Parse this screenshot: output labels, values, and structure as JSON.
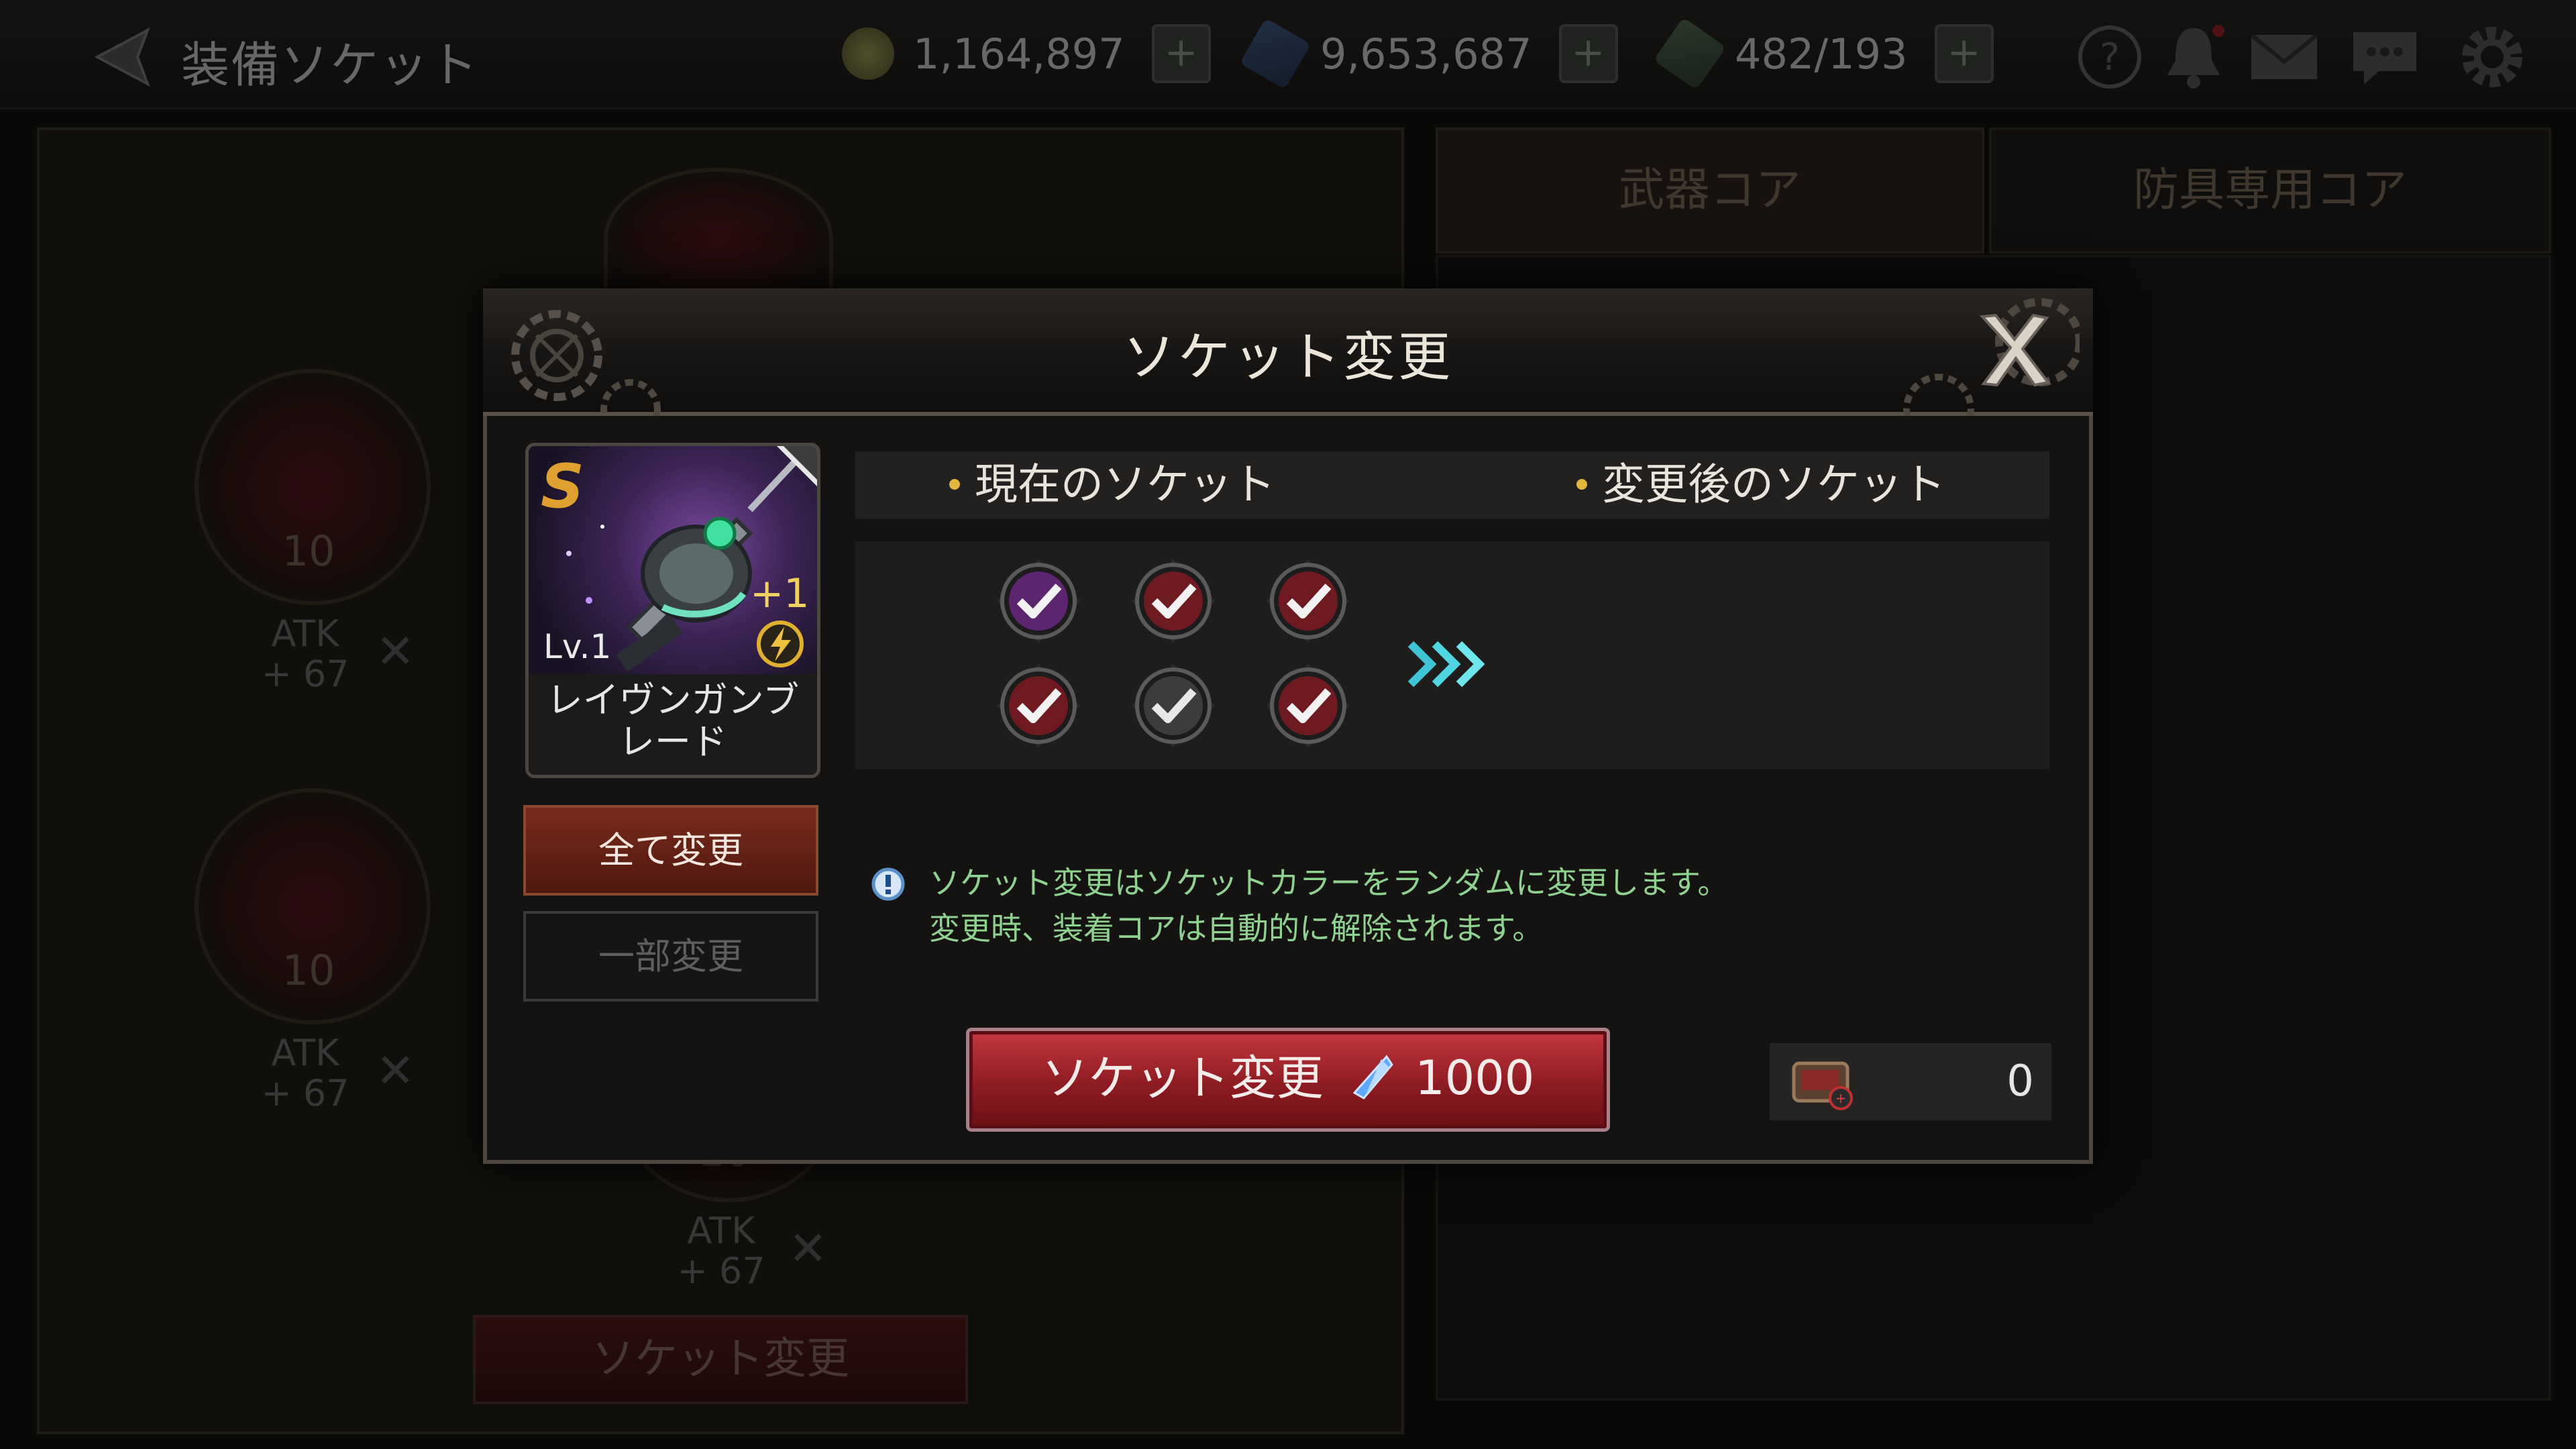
{
  "background": {
    "screen_title": "装備ソケット",
    "currencies": [
      {
        "name": "gold",
        "value": "1,164,897",
        "icon": "gold-icon"
      },
      {
        "name": "crystal",
        "value": "9,653,687",
        "icon": "crystal-icon"
      },
      {
        "name": "stamina",
        "value": "482/193",
        "icon": "stamina-icon"
      }
    ],
    "top_icons": [
      "help-icon",
      "bell-icon",
      "mail-icon",
      "chat-icon",
      "gear-icon"
    ],
    "tabs": [
      "武器コア",
      "防具専用コア"
    ],
    "slots": [
      {
        "number": "10",
        "stat_label": "ATK",
        "stat_value": "+ 67"
      },
      {
        "number": "10",
        "stat_label": "ATK",
        "stat_value": "+ 67"
      },
      {
        "number": "10",
        "stat_label": "ATK",
        "stat_value": "+ 67"
      }
    ],
    "socket_change_button": "ソケット変更"
  },
  "dialog": {
    "title": "ソケット変更",
    "item": {
      "grade": "S",
      "level": "Lv.1",
      "enhance": "+1",
      "name": "レイヴンガンブレード"
    },
    "mode_buttons": {
      "all": "全て変更",
      "partial": "一部変更"
    },
    "sockets_header": {
      "current": "現在のソケット",
      "after": "変更後のソケット"
    },
    "current_sockets": [
      {
        "color": "purple"
      },
      {
        "color": "red"
      },
      {
        "color": "red"
      },
      {
        "color": "red"
      },
      {
        "color": "gray"
      },
      {
        "color": "red"
      }
    ],
    "info_lines": [
      "ソケット変更はソケットカラーをランダムに変更します。",
      "変更時、装着コアは自動的に解除されます。"
    ],
    "change_button": {
      "label": "ソケット変更",
      "cost_icon": "crystal-icon",
      "cost": "1000"
    },
    "owned_item": {
      "icon": "socket-ticket-icon",
      "count": "0"
    }
  },
  "colors": {
    "accent_red": "#a8232b",
    "info_green": "#8fd18f",
    "bullet_gold": "#e3b640"
  }
}
